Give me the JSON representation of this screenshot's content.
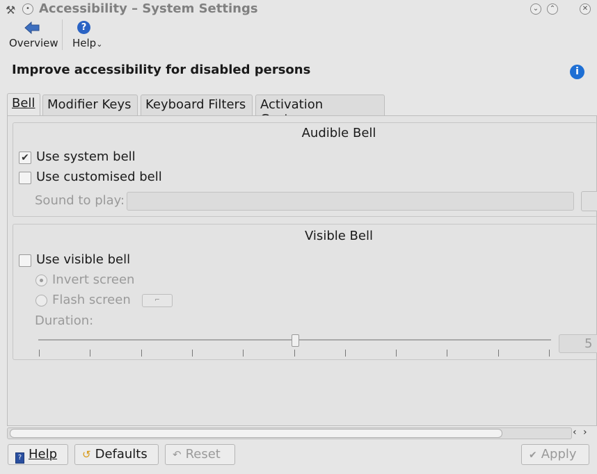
{
  "window": {
    "title": "Accessibility – System Settings",
    "titlebar_buttons": [
      "minimize-icon",
      "maximize-icon",
      "close-icon"
    ]
  },
  "toolbar": {
    "overview_label": "Overview",
    "help_label": "Help",
    "help_suffix": "⌄"
  },
  "header": {
    "title": "Improve accessibility for disabled persons",
    "info_glyph": "i"
  },
  "tabs": [
    {
      "label": "Bell",
      "active": true
    },
    {
      "label": "Modifier Keys",
      "active": false
    },
    {
      "label": "Keyboard Filters",
      "active": false
    },
    {
      "label": "Activation Gestures",
      "active": false
    }
  ],
  "audible_bell": {
    "title": "Audible Bell",
    "use_system_bell": {
      "label": "Use system bell",
      "checked": true
    },
    "use_customised_bell": {
      "label": "Use customised bell",
      "checked": false
    },
    "sound_to_play_label": "Sound to play:",
    "sound_to_play_value": ""
  },
  "visible_bell": {
    "title": "Visible Bell",
    "use_visible_bell": {
      "label": "Use visible bell",
      "checked": false
    },
    "invert_screen": {
      "label": "Invert screen",
      "selected": true
    },
    "flash_screen": {
      "label": "Flash screen",
      "selected": false
    },
    "duration_label": "Duration:",
    "duration_value": "5",
    "duration_slider_fraction": 0.5,
    "tick_count": 11
  },
  "bottom": {
    "help": "Help",
    "defaults": "Defaults",
    "reset": "Reset",
    "apply": "Apply"
  },
  "colors": {
    "accent": "#1e6fd4",
    "window_bg": "#e6e6e6",
    "disabled_text": "#9a9a9a"
  }
}
